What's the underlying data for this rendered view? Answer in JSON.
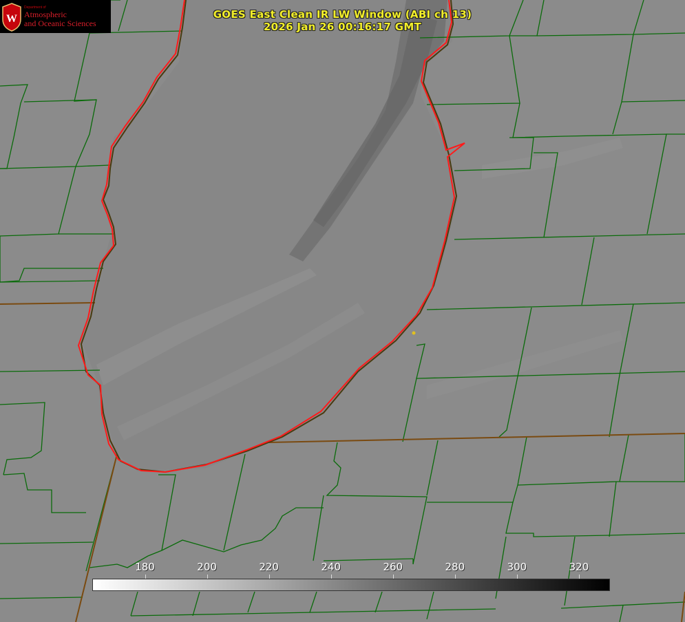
{
  "title_line1": "GOES East Clean IR LW Window (ABI ch 13)",
  "title_line2": "2026 Jan 26 00:16:17 GMT",
  "logo": {
    "department": "Department of",
    "line1": "Atmospheric",
    "line2": "and Oceanic Sciences",
    "color": "#d81e2a"
  },
  "colorbar": {
    "min": 163,
    "max": 330,
    "ticks": [
      180,
      200,
      220,
      240,
      260,
      280,
      300,
      320
    ],
    "colors": [
      "#ffffff",
      "#000000"
    ]
  },
  "colors": {
    "county_lines": "#0a6b0a",
    "state_lines": "#7a4a10",
    "coastline": "#ff1a1a",
    "title": "#f2ee2a",
    "marker": "#e0c020"
  }
}
